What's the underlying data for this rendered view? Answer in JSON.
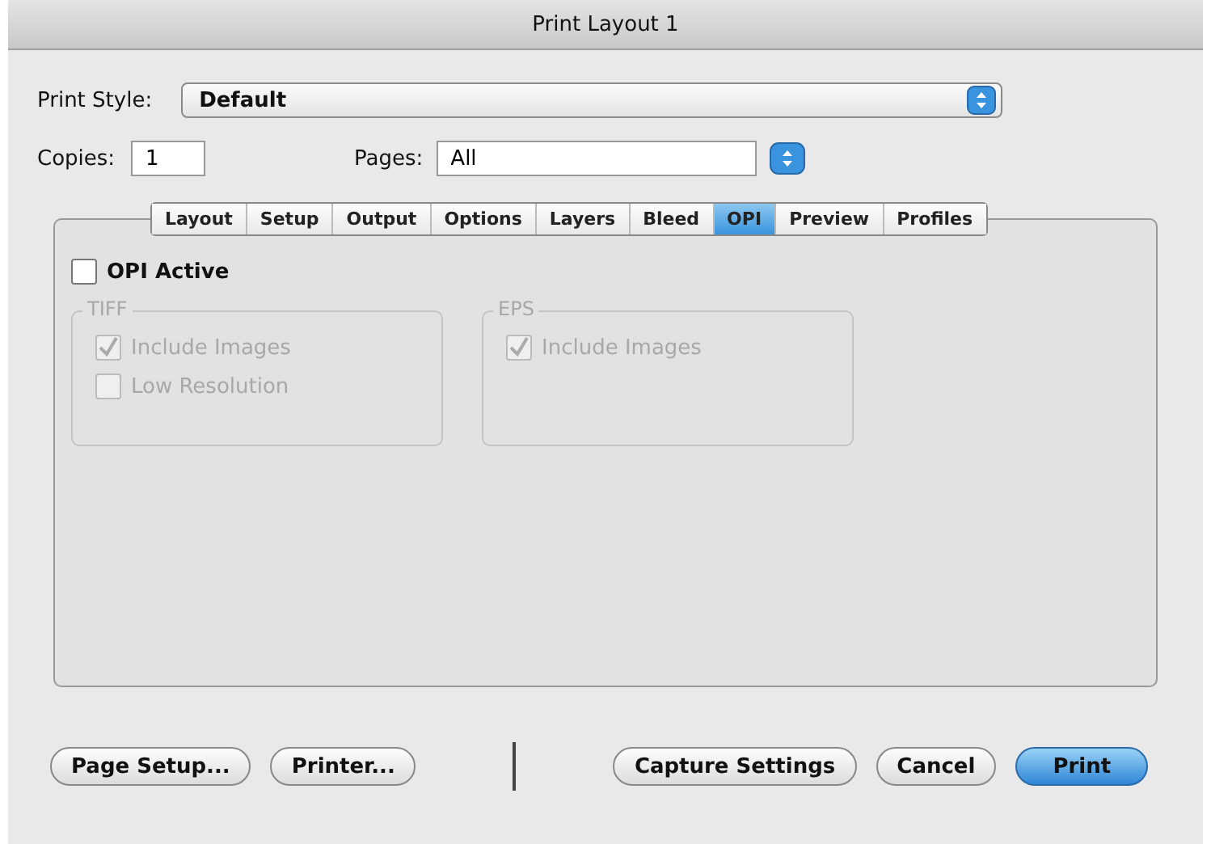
{
  "window": {
    "title": "Print Layout 1"
  },
  "print_style": {
    "label": "Print Style:",
    "value": "Default"
  },
  "copies": {
    "label": "Copies:",
    "value": "1"
  },
  "pages": {
    "label": "Pages:",
    "value": "All"
  },
  "tabs": [
    {
      "label": "Layout",
      "selected": false
    },
    {
      "label": "Setup",
      "selected": false
    },
    {
      "label": "Output",
      "selected": false
    },
    {
      "label": "Options",
      "selected": false
    },
    {
      "label": "Layers",
      "selected": false
    },
    {
      "label": "Bleed",
      "selected": false
    },
    {
      "label": "OPI",
      "selected": true
    },
    {
      "label": "Preview",
      "selected": false
    },
    {
      "label": "Profiles",
      "selected": false
    }
  ],
  "opi_active": {
    "label": "OPI Active",
    "checked": false,
    "disabled": false
  },
  "groups": [
    {
      "title": "TIFF",
      "disabled": true,
      "options": [
        {
          "label": "Include Images",
          "checked": true,
          "disabled": true
        },
        {
          "label": "Low Resolution",
          "checked": false,
          "disabled": true
        }
      ]
    },
    {
      "title": "EPS",
      "disabled": true,
      "options": [
        {
          "label": "Include Images",
          "checked": true,
          "disabled": true
        }
      ]
    }
  ],
  "buttons_left": [
    {
      "label": "Page Setup...",
      "default": false
    },
    {
      "label": "Printer...",
      "default": false
    }
  ],
  "buttons_right": [
    {
      "label": "Capture Settings",
      "default": false
    },
    {
      "label": "Cancel",
      "default": false
    },
    {
      "label": "Print",
      "default": true
    }
  ]
}
